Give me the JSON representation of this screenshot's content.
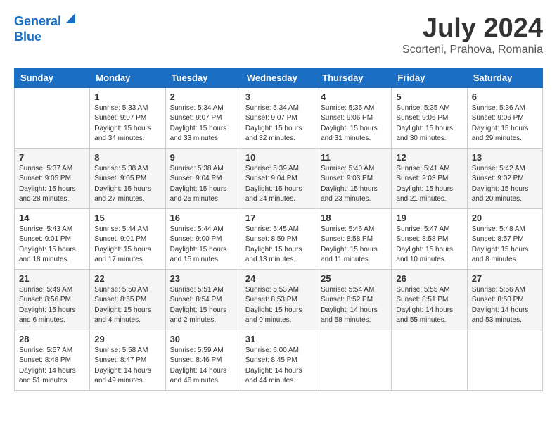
{
  "logo": {
    "line1": "General",
    "line2": "Blue"
  },
  "title": "July 2024",
  "subtitle": "Scorteni, Prahova, Romania",
  "weekdays": [
    "Sunday",
    "Monday",
    "Tuesday",
    "Wednesday",
    "Thursday",
    "Friday",
    "Saturday"
  ],
  "weeks": [
    [
      {
        "day": null,
        "info": null
      },
      {
        "day": "1",
        "sunrise": "5:33 AM",
        "sunset": "9:07 PM",
        "daylight": "15 hours and 34 minutes."
      },
      {
        "day": "2",
        "sunrise": "5:34 AM",
        "sunset": "9:07 PM",
        "daylight": "15 hours and 33 minutes."
      },
      {
        "day": "3",
        "sunrise": "5:34 AM",
        "sunset": "9:07 PM",
        "daylight": "15 hours and 32 minutes."
      },
      {
        "day": "4",
        "sunrise": "5:35 AM",
        "sunset": "9:06 PM",
        "daylight": "15 hours and 31 minutes."
      },
      {
        "day": "5",
        "sunrise": "5:35 AM",
        "sunset": "9:06 PM",
        "daylight": "15 hours and 30 minutes."
      },
      {
        "day": "6",
        "sunrise": "5:36 AM",
        "sunset": "9:06 PM",
        "daylight": "15 hours and 29 minutes."
      }
    ],
    [
      {
        "day": "7",
        "sunrise": "5:37 AM",
        "sunset": "9:05 PM",
        "daylight": "15 hours and 28 minutes."
      },
      {
        "day": "8",
        "sunrise": "5:38 AM",
        "sunset": "9:05 PM",
        "daylight": "15 hours and 27 minutes."
      },
      {
        "day": "9",
        "sunrise": "5:38 AM",
        "sunset": "9:04 PM",
        "daylight": "15 hours and 25 minutes."
      },
      {
        "day": "10",
        "sunrise": "5:39 AM",
        "sunset": "9:04 PM",
        "daylight": "15 hours and 24 minutes."
      },
      {
        "day": "11",
        "sunrise": "5:40 AM",
        "sunset": "9:03 PM",
        "daylight": "15 hours and 23 minutes."
      },
      {
        "day": "12",
        "sunrise": "5:41 AM",
        "sunset": "9:03 PM",
        "daylight": "15 hours and 21 minutes."
      },
      {
        "day": "13",
        "sunrise": "5:42 AM",
        "sunset": "9:02 PM",
        "daylight": "15 hours and 20 minutes."
      }
    ],
    [
      {
        "day": "14",
        "sunrise": "5:43 AM",
        "sunset": "9:01 PM",
        "daylight": "15 hours and 18 minutes."
      },
      {
        "day": "15",
        "sunrise": "5:44 AM",
        "sunset": "9:01 PM",
        "daylight": "15 hours and 17 minutes."
      },
      {
        "day": "16",
        "sunrise": "5:44 AM",
        "sunset": "9:00 PM",
        "daylight": "15 hours and 15 minutes."
      },
      {
        "day": "17",
        "sunrise": "5:45 AM",
        "sunset": "8:59 PM",
        "daylight": "15 hours and 13 minutes."
      },
      {
        "day": "18",
        "sunrise": "5:46 AM",
        "sunset": "8:58 PM",
        "daylight": "15 hours and 11 minutes."
      },
      {
        "day": "19",
        "sunrise": "5:47 AM",
        "sunset": "8:58 PM",
        "daylight": "15 hours and 10 minutes."
      },
      {
        "day": "20",
        "sunrise": "5:48 AM",
        "sunset": "8:57 PM",
        "daylight": "15 hours and 8 minutes."
      }
    ],
    [
      {
        "day": "21",
        "sunrise": "5:49 AM",
        "sunset": "8:56 PM",
        "daylight": "15 hours and 6 minutes."
      },
      {
        "day": "22",
        "sunrise": "5:50 AM",
        "sunset": "8:55 PM",
        "daylight": "15 hours and 4 minutes."
      },
      {
        "day": "23",
        "sunrise": "5:51 AM",
        "sunset": "8:54 PM",
        "daylight": "15 hours and 2 minutes."
      },
      {
        "day": "24",
        "sunrise": "5:53 AM",
        "sunset": "8:53 PM",
        "daylight": "15 hours and 0 minutes."
      },
      {
        "day": "25",
        "sunrise": "5:54 AM",
        "sunset": "8:52 PM",
        "daylight": "14 hours and 58 minutes."
      },
      {
        "day": "26",
        "sunrise": "5:55 AM",
        "sunset": "8:51 PM",
        "daylight": "14 hours and 55 minutes."
      },
      {
        "day": "27",
        "sunrise": "5:56 AM",
        "sunset": "8:50 PM",
        "daylight": "14 hours and 53 minutes."
      }
    ],
    [
      {
        "day": "28",
        "sunrise": "5:57 AM",
        "sunset": "8:48 PM",
        "daylight": "14 hours and 51 minutes."
      },
      {
        "day": "29",
        "sunrise": "5:58 AM",
        "sunset": "8:47 PM",
        "daylight": "14 hours and 49 minutes."
      },
      {
        "day": "30",
        "sunrise": "5:59 AM",
        "sunset": "8:46 PM",
        "daylight": "14 hours and 46 minutes."
      },
      {
        "day": "31",
        "sunrise": "6:00 AM",
        "sunset": "8:45 PM",
        "daylight": "14 hours and 44 minutes."
      },
      {
        "day": null,
        "info": null
      },
      {
        "day": null,
        "info": null
      },
      {
        "day": null,
        "info": null
      }
    ]
  ]
}
